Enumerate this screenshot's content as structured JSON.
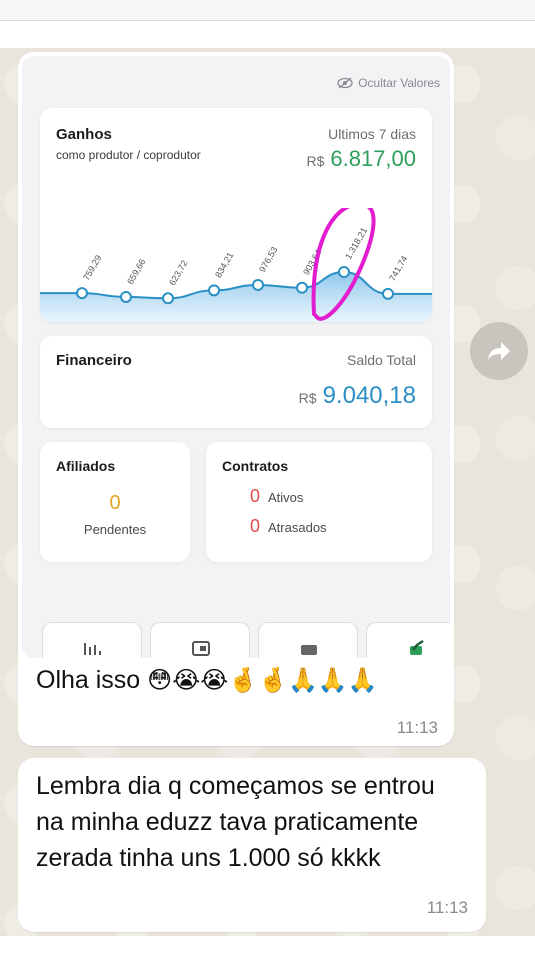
{
  "dashboard": {
    "hide_values_label": "Ocultar Valores",
    "earnings": {
      "title": "Ganhos",
      "subtitle": "como produtor / coprodutor",
      "period": "Ultimos 7 dias",
      "currency": "R$",
      "amount": "6.817,00",
      "amount_color": "#2e9e5b"
    },
    "financial": {
      "title": "Financeiro",
      "label": "Saldo Total",
      "currency": "R$",
      "amount": "9.040,18",
      "amount_color": "#2a8fc5"
    },
    "affiliates": {
      "title": "Afiliados",
      "count": "0",
      "label": "Pendentes"
    },
    "contracts": {
      "title": "Contratos",
      "active_count": "0",
      "active_label": "Ativos",
      "late_count": "0",
      "late_label": "Atrasados"
    },
    "bottom_tabs": [
      {
        "icon": "bar-chart-icon"
      },
      {
        "icon": "wallet-icon"
      },
      {
        "icon": "card-icon"
      },
      {
        "icon": "check-icon"
      }
    ]
  },
  "chart_data": {
    "type": "area",
    "x": [
      1,
      2,
      3,
      4,
      5,
      6,
      7,
      8
    ],
    "values": [
      759.29,
      659.66,
      623.72,
      834.21,
      976.53,
      903.64,
      1318.21,
      741.74
    ],
    "labels": [
      "759,29",
      "659,66",
      "623,72",
      "834,21",
      "976,53",
      "903,64",
      "1.318,21",
      "741,74"
    ],
    "series_color": "#2a8fc5",
    "highlight_color": "#e21ccf"
  },
  "messages": [
    {
      "text": "Olha isso",
      "emojis": "😳😭😭🤞🤞🙏🙏🙏",
      "time": "11:13"
    },
    {
      "text": "Lembra dia q começamos se entrou na minha eduzz tava praticamente zerada tinha uns 1.000 só kkkk",
      "time": "11:13"
    }
  ]
}
